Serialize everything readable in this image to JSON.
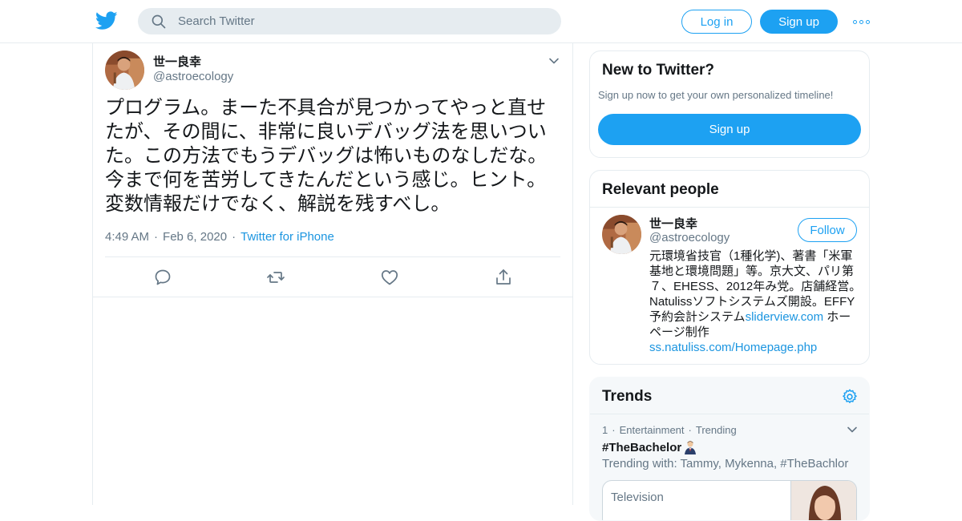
{
  "header": {
    "search_placeholder": "Search Twitter",
    "login_label": "Log in",
    "signup_label": "Sign up"
  },
  "tweet": {
    "author_name": "世一良幸",
    "author_handle": "@astroecology",
    "text": "プログラム。まーた不具合が見つかってやっと直せたが、その間に、非常に良いデバッグ法を思いついた。この方法でもうデバッグは怖いものなしだな。今まで何を苦労してきたんだという感じ。ヒント。変数情報だけでなく、解説を残すべし。",
    "time": "4:49 AM",
    "date": "Feb 6, 2020",
    "source": "Twitter for iPhone",
    "separator": "·"
  },
  "new_to_twitter": {
    "title": "New to Twitter?",
    "subtitle": "Sign up now to get your own personalized timeline!",
    "signup_label": "Sign up"
  },
  "relevant_people": {
    "title": "Relevant people",
    "name": "世一良幸",
    "handle": "@astroecology",
    "follow_label": "Follow",
    "bio_text": "元環境省技官（1種化学)、著書「米軍基地と環境問題」等。京大文、パリ第７、EHESS、2012年み党。店舗経営。Natulissソフトシステムズ開設。EFFY予約会計システム",
    "bio_link1": "sliderview.com",
    "bio_text2": " ホーページ制作",
    "bio_link2": "ss.natuliss.com/Homepage.php"
  },
  "trends": {
    "title": "Trends",
    "rank": "1",
    "category": "Entertainment",
    "status": "Trending",
    "separator": "·",
    "hashtag": "#TheBachelor",
    "trending_with": "Trending with: Tammy, Mykenna, #TheBachlor",
    "card_category": "Television"
  },
  "colors": {
    "accent": "#1da1f2",
    "link": "#1b95e0",
    "secondary_text": "#657786",
    "border": "#e6ecf0"
  }
}
